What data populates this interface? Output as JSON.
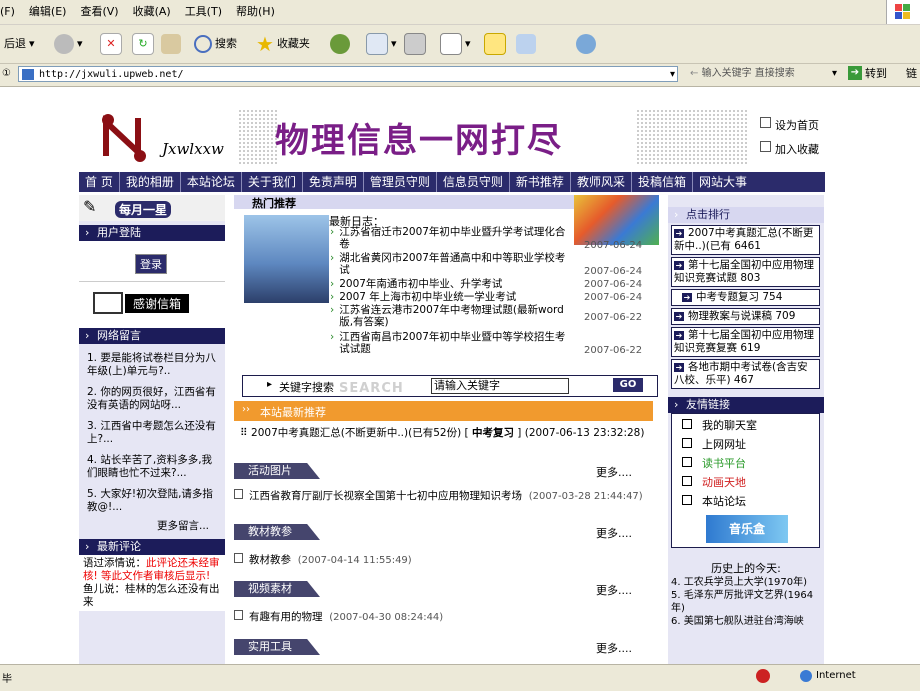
{
  "menu": [
    "(F)",
    "编辑(E)",
    "查看(V)",
    "收藏(A)",
    "工具(T)",
    "帮助(H)"
  ],
  "toolbar": {
    "back": "后退",
    "search": "搜索",
    "favorites": "收藏夹"
  },
  "address": {
    "url": "http://jxwuli.upweb.net/",
    "search_placeholder": "输入关键字 直接搜索",
    "go": "转到",
    "links": "链"
  },
  "site": {
    "logo_text": "Jxwlxxw",
    "title": "物理信息一网打尽",
    "set_home": "设为首页",
    "add_fav": "加入收藏",
    "nav": [
      "首 页",
      "我的相册",
      "本站论坛",
      "关于我们",
      "免责声明",
      "管理员守则",
      "信息员守则",
      "新书推荐",
      "教师风采",
      "投稿信箱",
      "网站大事"
    ]
  },
  "left": {
    "banner": "每月一星",
    "login_hdr": "用户登陆",
    "login_btn": "登录",
    "mailbox": "感谢信箱",
    "msg_hdr": "网络留言",
    "messages": [
      "1. 要是能将试卷栏目分为八年级(上)单元与?..",
      "2. 你的网页很好，江西省有没有英语的网站呀...",
      "3. 江西省中考题怎么还没有上?...",
      "4. 站长辛苦了,资料多多,我们眼睛也忙不过来?...",
      "5. 大家好!初次登陆,请多指教@!..."
    ],
    "more_msg": "更多留言...",
    "comment_hdr": "最新评论",
    "comment1_author": "语过添情说：",
    "comment1_text": "此评论还未经审核! 等此文作者审核后显示!",
    "comment2": "鱼儿说：桂林的怎么还没有出来"
  },
  "center": {
    "hot_hdr": "热门推荐",
    "log_title": "最新日志：",
    "logs": [
      {
        "title": "江苏省宿迁市2007年初中毕业暨升学考试理化合卷",
        "date": "2007-06-24"
      },
      {
        "title": "湖北省黄冈市2007年普通高中和中等职业学校考试",
        "date": "2007-06-24"
      },
      {
        "title": "2007年南通市初中毕业、升学考试",
        "date": "2007-06-24"
      },
      {
        "title": "2007 年上海市初中毕业统一学业考试",
        "date": "2007-06-24"
      },
      {
        "title": "江苏省连云港市2007年中考物理试题(最新word版,有答案)",
        "date": "2007-06-22"
      },
      {
        "title": "江西省南昌市2007年初中毕业暨中等学校招生考试试题",
        "date": "2007-06-22"
      }
    ],
    "kw_label": "关键字搜索",
    "kw_watermark": "SEARCH",
    "kw_input": "请输入关键字",
    "go_btn": "GO",
    "rec_hdr": "本站最新推荐",
    "rec_text": "2007中考真题汇总(不断更新中..)(已有52份)",
    "rec_cat": "中考复习",
    "rec_date": "(2007-06-13 23:32:28)",
    "sections": [
      {
        "name": "活动图片",
        "more": "更多....",
        "item": "江西省教育厅副厅长视察全国第十七初中应用物理知识考场",
        "date": "(2007-03-28 21:44:47)"
      },
      {
        "name": "教材教参",
        "more": "更多....",
        "item": "教材教参",
        "date": "(2007-04-14 11:55:49)"
      },
      {
        "name": "视频素材",
        "more": "更多....",
        "item": "有趣有用的物理",
        "date": "(2007-04-30 08:24:44)"
      },
      {
        "name": "实用工具",
        "more": "更多....",
        "item": "",
        "date": ""
      }
    ]
  },
  "right": {
    "rank_hdr": "点击排行",
    "ranks": [
      "2007中考真题汇总(不断更新中..)(已有 6461",
      "第十七届全国初中应用物理知识竞赛试题 803",
      "中考专题复习 754",
      "物理教案与说课稿 709",
      "第十七届全国初中应用物理知识竞赛复赛 619",
      "各地市期中考试卷(含吉安八校、乐平) 467"
    ],
    "links_hdr": "友情链接",
    "links": [
      "我的聊天室",
      "上网网址",
      "读书平台",
      "动画天地",
      "本站论坛"
    ],
    "music": "音乐盒",
    "history_title": "历史上的今天:",
    "history": [
      "4. 工农兵学员上大学(1970年)",
      "5. 毛泽东严厉批评文艺界(1964年)",
      "6. 美国第七舰队进驻台湾海峡"
    ]
  },
  "status": {
    "left": "毕",
    "zone": "Internet"
  }
}
